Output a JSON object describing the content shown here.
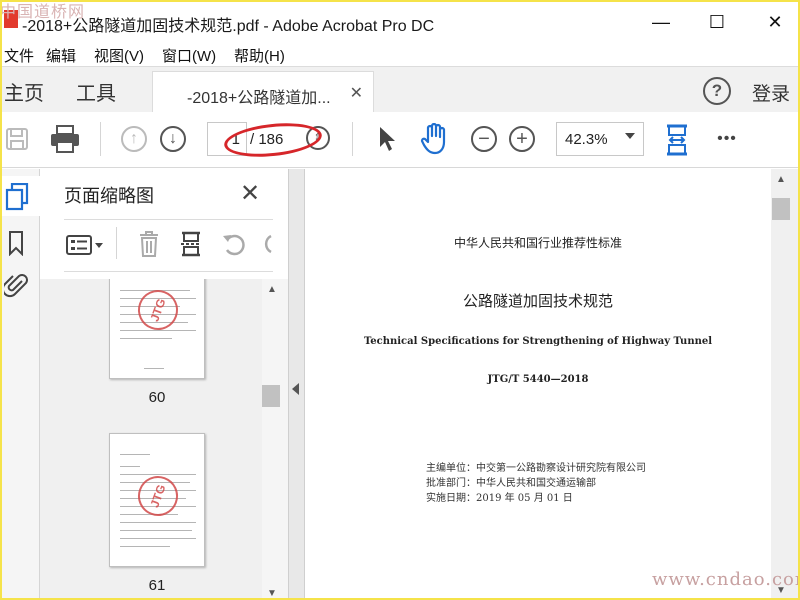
{
  "window": {
    "title": "-2018+公路隧道加固技术规范.pdf - Adobe Acrobat Pro DC",
    "minimize": "—",
    "maximize": "☐",
    "close": "✕",
    "watermark_top": "中国道桥网"
  },
  "menu": [
    "文件",
    "编辑",
    "视图(V)",
    "窗口(W)",
    "帮助(H)"
  ],
  "tabs": {
    "home": "主页",
    "tools": "工具",
    "document": "-2018+公路隧道加...",
    "document_close": "✕",
    "help": "?",
    "login": "登录"
  },
  "toolbar": {
    "current_page": "1",
    "total_pages": "/ 186",
    "zoom": "42.3%",
    "more": "•••",
    "icons": [
      "save-icon",
      "print-icon",
      "page-up-icon",
      "page-down-icon",
      "select-cursor-icon",
      "hand-tool-icon",
      "zoom-out-icon",
      "zoom-in-icon",
      "fit-page-icon",
      "more-icon"
    ],
    "annotation_color": "#d6262a"
  },
  "panel": {
    "title": "页面缩略图",
    "close": "✕",
    "thumbnails": [
      {
        "label": "60",
        "stamp": "JTG"
      },
      {
        "label": "61",
        "stamp": "JTG"
      }
    ]
  },
  "document": {
    "header": "中华人民共和国行业推荐性标准",
    "title_cn": "公路隧道加固技术规范",
    "title_en": "Technical Specifications for Strengthening of Highway Tunnel",
    "code": "JTG/T 5440—2018",
    "editor": "主编单位：中交第一公路勘察设计研究院有限公司",
    "approver": "批准部门：中华人民共和国交通运输部",
    "effective": "实施日期：2019 年 05 月 01 日"
  },
  "watermark_bottom": "www.cndao.com",
  "colors": {
    "accent_blue": "#1f6fd0",
    "frame_yellow": "#f5e34a",
    "stamp_red": "#d24a4a"
  }
}
